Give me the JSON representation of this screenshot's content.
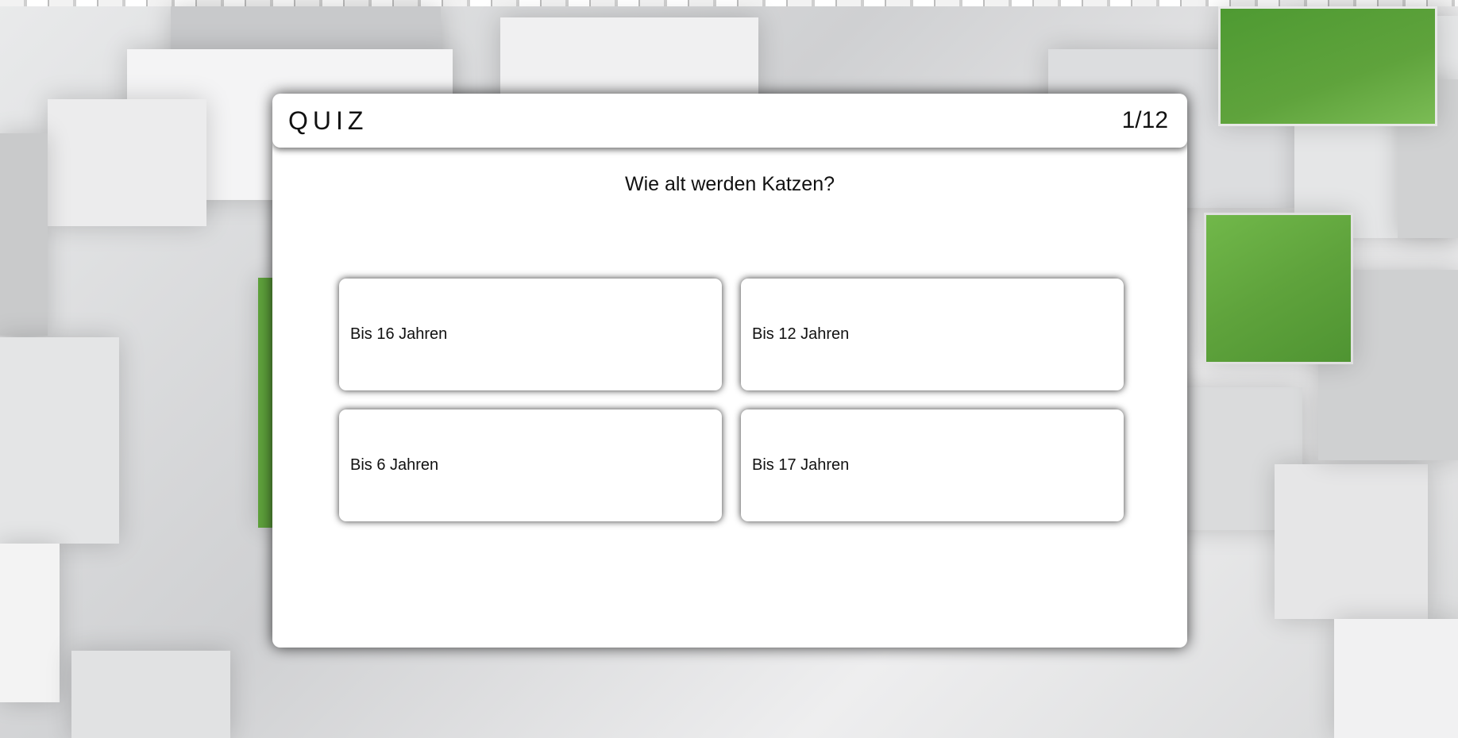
{
  "quiz": {
    "title": "QUIZ",
    "progress": "1/12",
    "question": "Wie alt werden Katzen?",
    "answers": [
      {
        "label": "Bis 16 Jahren"
      },
      {
        "label": "Bis 12 Jahren"
      },
      {
        "label": "Bis 6 Jahren"
      },
      {
        "label": "Bis 17 Jahren"
      }
    ]
  },
  "colors": {
    "accent_green": "#5fa33c",
    "background_gray": "#d3d4d5",
    "card": "#ffffff"
  }
}
